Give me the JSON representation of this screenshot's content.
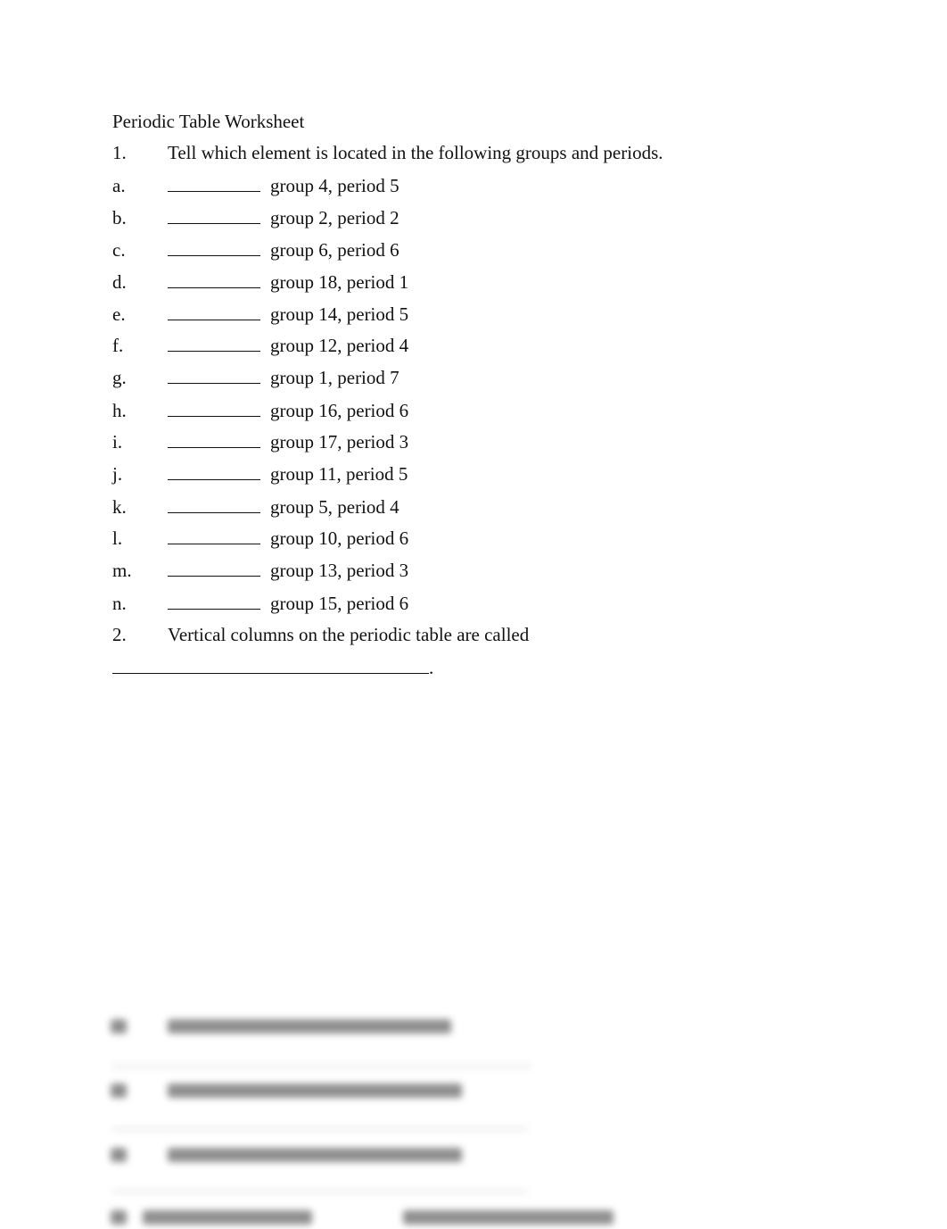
{
  "document": {
    "title": "Periodic Table Worksheet",
    "question1": {
      "number": "1.",
      "prompt": "Tell which element is located in the following groups and periods.",
      "items": [
        {
          "label": "a.",
          "text": "group 4, period 5"
        },
        {
          "label": "b.",
          "text": "group 2, period 2"
        },
        {
          "label": "c.",
          "text": "group 6, period 6"
        },
        {
          "label": "d.",
          "text": "group 18, period 1"
        },
        {
          "label": "e.",
          "text": "group 14, period 5"
        },
        {
          "label": "f.",
          "text": "group 12, period 4"
        },
        {
          "label": "g.",
          "text": "group 1, period 7"
        },
        {
          "label": "h.",
          "text": "group 16, period 6"
        },
        {
          "label": "i.",
          "text": "group 17, period 3"
        },
        {
          "label": "j.",
          "text": "group 11, period 5"
        },
        {
          "label": "k.",
          "text": "group 5, period 4"
        },
        {
          "label": "l.",
          "text": "group 10, period 6"
        },
        {
          "label": "m.",
          "text": "group 13, period 3"
        },
        {
          "label": "n.",
          "text": "group 15, period 6"
        }
      ]
    },
    "question2": {
      "number": "2.",
      "prompt": "Vertical columns on the periodic table are called",
      "end_punctuation": "."
    },
    "blurred_preview": true
  }
}
